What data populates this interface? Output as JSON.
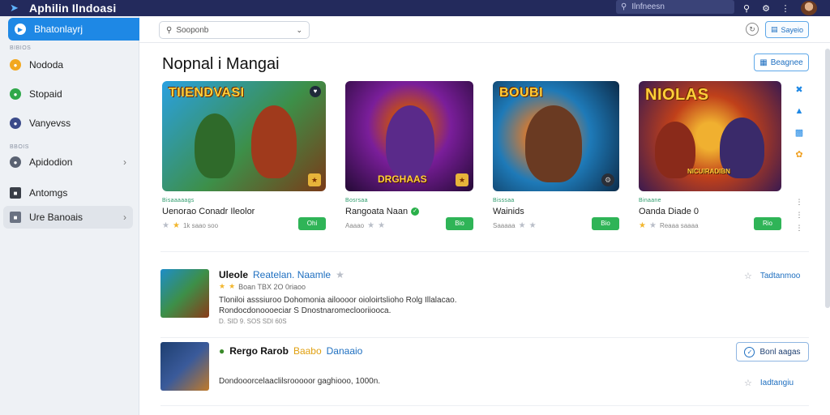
{
  "titlebar": {
    "app_title": "Aphilin Ilndoasi",
    "search_placeholder": "Ilnfneesn"
  },
  "sidebar": {
    "active_item": "Bhatonlayrj",
    "section_1": "BIBIOS",
    "items_1": [
      "Nododa",
      "Stopaid",
      "Vanyevss"
    ],
    "section_2": "BBOIS",
    "items_2": [
      "Apidodion",
      "Antomgs",
      "Ure Banoais"
    ]
  },
  "toolbar": {
    "filter_placeholder": "Sooponb",
    "share_label": "Sayeio"
  },
  "page": {
    "title": "Nopnal i Mangai",
    "action_label": "Beagnee"
  },
  "cards": [
    {
      "logo": "TIIENDVASI",
      "tag": "Bisaaaaags",
      "name": "Uenorao Conadr Ileolor",
      "meta": "1k saao soo",
      "get": "Ohi",
      "colors": [
        "#1d7fc4",
        "#5ab84a",
        "#ad3e1c"
      ]
    },
    {
      "logo": "",
      "bottom": "DRGHAAS",
      "tag": "Bosrsaa",
      "name": "Rangoata Naan",
      "meta": "Aaaao",
      "get": "Bio",
      "colors": [
        "#2a0d3f",
        "#8c2ac0",
        "#e04a18"
      ]
    },
    {
      "logo": "BOUBI",
      "tag": "Bisssaa",
      "name": "Wainids",
      "meta": "Saaaaa",
      "get": "Bio",
      "colors": [
        "#0f4f7a",
        "#1e8dc8",
        "#c85a1e"
      ]
    },
    {
      "logo": "NIOLAS",
      "bottom": "NICUIRADIBN",
      "tag": "Binaane",
      "name": "Oanda Diade 0",
      "meta": "Reaaa saaaa",
      "get": "Rio",
      "colors": [
        "#3a1a50",
        "#c43a1a",
        "#f0a020"
      ]
    }
  ],
  "list": [
    {
      "title": "Uleole",
      "subtitle": "Reatelan. Naamle",
      "meta": "Boan   TBX 2O 0riaoo",
      "desc": "Tloniloi asssiuroo Dohomonia ailoooor oioloirtslioho Rolg Illalacao. Rondocdonoooeciar S Dnostnaromeclooriiooca.",
      "stats": "D. SID 9.  SOS SDI 60S",
      "link": "Tadtanmoo"
    },
    {
      "title": "Rergo Rarob",
      "badge": "Baabo",
      "subtitle": "Danaaio",
      "desc": "Dondooorcelaaclilsrooooor gaghiooo, 1000n.",
      "button": "Bonl aagas",
      "link": "Iadtangiu"
    }
  ],
  "icons": {
    "logo": "bolt-icon",
    "search": "search-icon"
  }
}
